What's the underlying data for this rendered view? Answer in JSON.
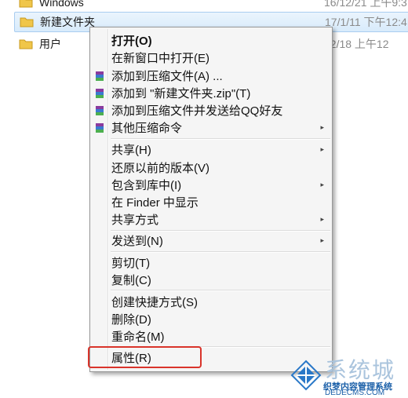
{
  "files": [
    {
      "name": "Windows",
      "date": "16/12/21 上午9:3"
    },
    {
      "name": "新建文件夹",
      "date": "17/1/11 下午12:4"
    },
    {
      "name": "用户",
      "date": "12/18 上午12"
    }
  ],
  "menu": {
    "open": "打开(O)",
    "open_new_window": "在新窗口中打开(E)",
    "add_archive": "添加到压缩文件(A) ...",
    "add_zip": "添加到 \"新建文件夹.zip\"(T)",
    "add_archive_qq": "添加到压缩文件并发送给QQ好友",
    "other_compress": "其他压缩命令",
    "share": "共享(H)",
    "restore_versions": "还原以前的版本(V)",
    "include_library": "包含到库中(I)",
    "show_in_finder": "在 Finder 中显示",
    "share_method": "共享方式",
    "send_to": "发送到(N)",
    "cut": "剪切(T)",
    "copy": "复制(C)",
    "create_shortcut": "创建快捷方式(S)",
    "delete": "删除(D)",
    "rename": "重命名(M)",
    "properties": "属性(R)"
  },
  "watermark": {
    "big": "系统城",
    "small": "织梦内容管理系统",
    "url": "DEDECMS.COM",
    "brand_color": "#1a5fa8"
  }
}
